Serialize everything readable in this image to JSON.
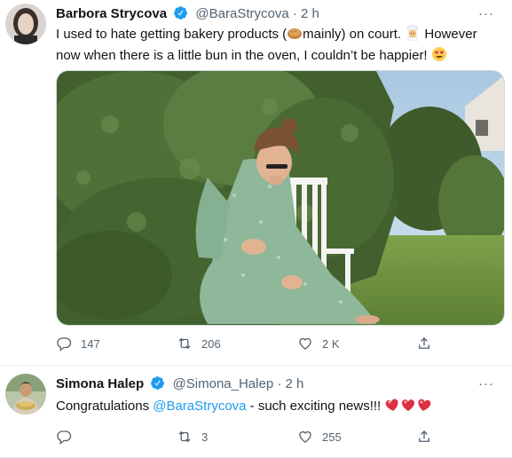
{
  "tweets": [
    {
      "author": "Barbora Strycova",
      "handle": "@BaraStrycova",
      "separator": "·",
      "time": "2 h",
      "text_part1": "I used to hate getting bakery products (",
      "text_part2": "mainly) on court.",
      "text_part3": "However now when there is a little bun in the oven, I couldn’t be happier!",
      "replies": "147",
      "retweets": "206",
      "likes": "2 K",
      "icons": [
        "verified-badge-icon",
        "bread-emoji-icon",
        "baker-emoji-icon",
        "heart-eyes-emoji-icon",
        "reply-icon",
        "retweet-icon",
        "like-icon",
        "share-icon"
      ]
    },
    {
      "author": "Simona Halep",
      "handle": "@Simona_Halep",
      "separator": "·",
      "time": "2 h",
      "text_prefix": "Congratulations ",
      "mention": "@BaraStrycova",
      "text_suffix": " - such exciting news!!!",
      "replies": "",
      "retweets": "3",
      "likes": "255",
      "icons": [
        "verified-badge-icon",
        "heart-emoji-icon",
        "reply-icon",
        "retweet-icon",
        "like-icon",
        "share-icon"
      ]
    }
  ],
  "more_label": "···",
  "colors": {
    "text": "#0f1419",
    "secondary": "#536471",
    "accent": "#1d9bf0",
    "heart": "#e0245e",
    "divider": "#e6ecf0"
  }
}
